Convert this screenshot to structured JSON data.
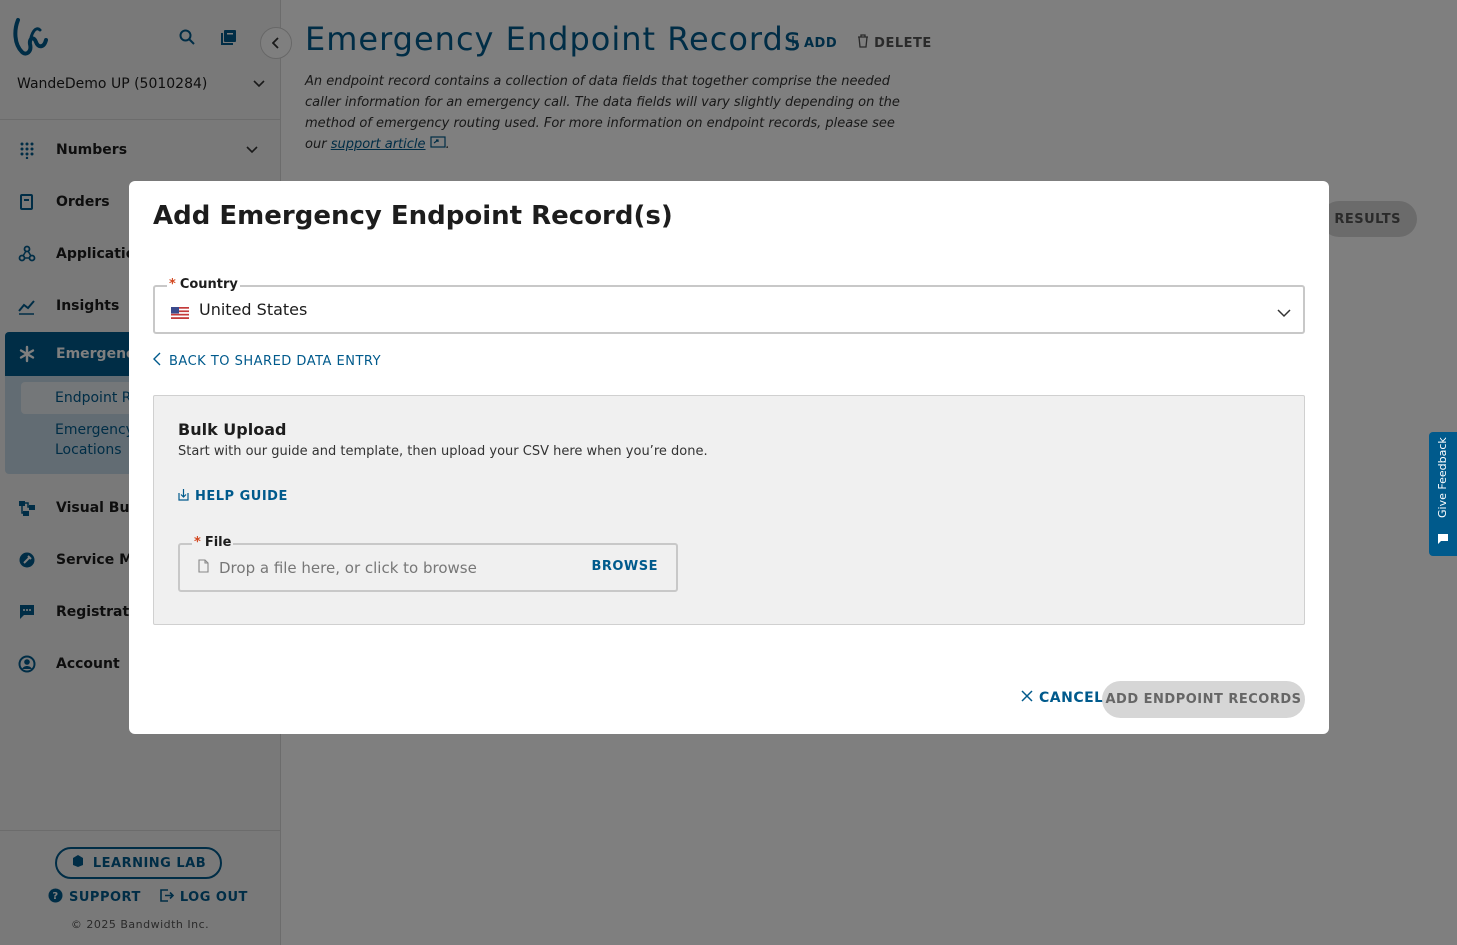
{
  "sidebar": {
    "account": "WandeDemo UP (5010284)",
    "items": [
      {
        "label": "Numbers",
        "icon": "grid-icon"
      },
      {
        "label": "Orders",
        "icon": "receipt-icon"
      },
      {
        "label": "Applications",
        "icon": "webhook-icon"
      },
      {
        "label": "Insights",
        "icon": "chart-icon"
      },
      {
        "label": "Emergency",
        "icon": "asterisk-icon"
      },
      {
        "label": "Visual Builder",
        "icon": "flow-icon"
      },
      {
        "label": "Service Management",
        "icon": "service-icon"
      },
      {
        "label": "Registration",
        "icon": "chat-icon"
      },
      {
        "label": "Account",
        "icon": "user-circle-icon"
      }
    ],
    "emergency_sub": [
      {
        "label": "Endpoint Records"
      },
      {
        "label": "Emergency Locations"
      }
    ],
    "learning_lab": "LEARNING LAB",
    "support": "SUPPORT",
    "logout": "LOG OUT",
    "copyright": "© 2025 Bandwidth Inc."
  },
  "main": {
    "title": "Emergency Endpoint Records",
    "add_label": "ADD",
    "delete_label": "DELETE",
    "description": "An endpoint record contains a collection of data fields that together comprise the needed caller information for an emergency call. The data fields will vary slightly depending on the method of emergency routing used. For more information on endpoint records, please see our",
    "description_link": "support article",
    "results_button": "SAVE RESULTS",
    "feedback": "Give Feedback"
  },
  "modal": {
    "title": "Add Emergency Endpoint Record(s)",
    "country_label": "Country",
    "country_value": "United States",
    "back_link": "BACK TO SHARED DATA ENTRY",
    "bulk_title": "Bulk Upload",
    "bulk_desc": "Start with our guide and template, then upload your CSV here when you’re done.",
    "help_guide": "HELP GUIDE",
    "file_label": "File",
    "file_placeholder": "Drop a file here, or click to browse",
    "browse": "BROWSE",
    "cancel": "CANCEL",
    "submit": "ADD ENDPOINT RECORDS"
  },
  "colors": {
    "accent": "#005a8c",
    "required": "#d2461e",
    "overlay": "rgba(0,0,0,0.5)"
  }
}
